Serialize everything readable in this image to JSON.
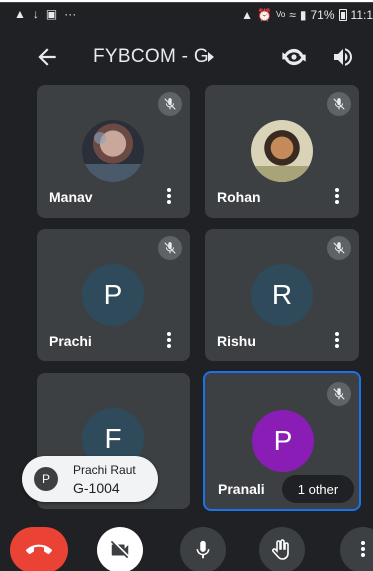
{
  "status_bar": {
    "battery": "71%",
    "time": "11:1"
  },
  "call": {
    "title": "FYBCOM - G"
  },
  "participants": [
    {
      "name": "Manav",
      "muted": true,
      "avatar": "photo"
    },
    {
      "name": "Rohan",
      "muted": true,
      "avatar": "photo"
    },
    {
      "name": "Prachi",
      "muted": true,
      "avatar": "P",
      "color": "#2f4a5a"
    },
    {
      "name": "Rishu",
      "muted": true,
      "avatar": "R",
      "color": "#2f4a5a"
    },
    {
      "name": "F",
      "muted": false,
      "avatar": "F",
      "color": "#2f4a5a"
    },
    {
      "name": "Pranali",
      "muted": true,
      "avatar": "P",
      "color": "#8a1db5",
      "active": true
    }
  ],
  "presenter_toast": {
    "initial": "P",
    "name": "Prachi Raut",
    "room": "G-1004"
  },
  "others_badge": "1 other",
  "controls": {
    "end_call": "end-call-icon",
    "camera": "camera-off-icon",
    "mic": "mic-icon",
    "raise_hand": "hand-icon",
    "more": "more-vert-icon"
  },
  "colors": {
    "background": "#202124",
    "tile": "#3c4043",
    "active_border": "#1a73e8",
    "end_call": "#ea4335"
  }
}
